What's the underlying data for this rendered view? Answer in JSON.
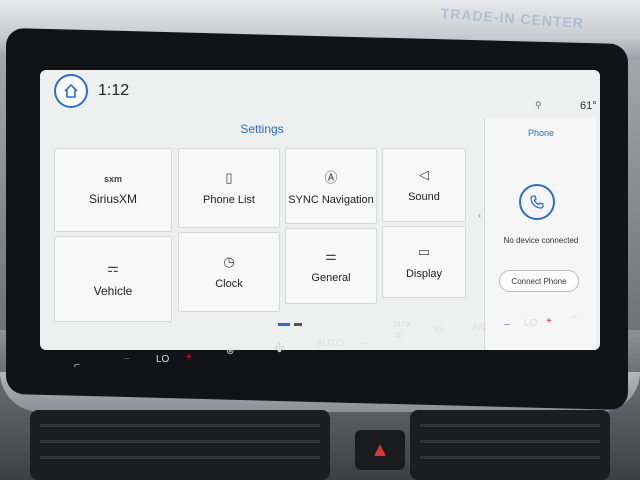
{
  "status": {
    "time": "1:12",
    "temperature": "61°"
  },
  "settings": {
    "title": "Settings",
    "tiles": [
      {
        "label": "SiriusXM",
        "icon": "sxm"
      },
      {
        "label": "Phone List",
        "icon": "▯"
      },
      {
        "label": "SYNC Navigation",
        "icon": "Ⓐ"
      },
      {
        "label": "Sound",
        "icon": "◁"
      },
      {
        "label": "Vehicle",
        "icon": "⚎"
      },
      {
        "label": "Clock",
        "icon": "◷"
      },
      {
        "label": "General",
        "icon": "⚌"
      },
      {
        "label": "Display",
        "icon": "▭"
      }
    ]
  },
  "phone": {
    "title": "Phone",
    "status": "No device connected",
    "connect_label": "Connect Phone"
  },
  "climate": {
    "left_temp": "LO",
    "right_temp": "LO",
    "auto_label": "AUTO",
    "max_label": "MAX",
    "ac_label": "A/C"
  },
  "colors": {
    "accent": "#2a6fd0",
    "hazard": "#d33333"
  }
}
